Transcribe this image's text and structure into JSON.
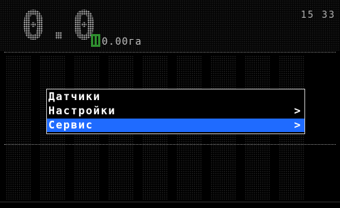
{
  "status": {
    "speed": "0.0",
    "area": "0.00га",
    "clock": "15 33"
  },
  "menu": {
    "items": [
      {
        "label": "Датчики",
        "has_submenu": false,
        "selected": false
      },
      {
        "label": "Настройки",
        "has_submenu": true,
        "selected": false
      },
      {
        "label": "Сервис",
        "has_submenu": true,
        "selected": true
      }
    ],
    "arrow_glyph": ">"
  },
  "colors": {
    "selection": "#1f6bff",
    "area_icon": "#2f8f2f",
    "background": "#000000"
  }
}
